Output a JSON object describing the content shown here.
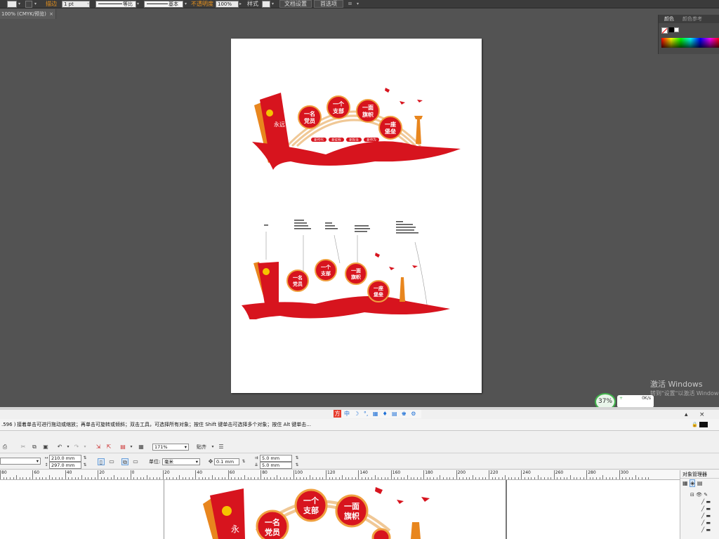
{
  "illustrator": {
    "control_bar": {
      "stroke_label": "描边",
      "stroke_weight": "1 pt",
      "uniform_label": "等比",
      "basic_label": "基本",
      "opacity_label": "不透明度",
      "opacity_value": "100%",
      "style_label": "样式",
      "document_setup_button": "文档设置",
      "preferences_button": "首选项"
    },
    "document_tab": {
      "label": "100% (CMYK/预览)",
      "close": "×"
    },
    "color_panel": {
      "tab_color": "颜色",
      "tab_color_guide": "颜色参考"
    },
    "accent_color": "#e8921c"
  },
  "artwork": {
    "circles": [
      "一名\n党员",
      "一个\n支部",
      "一面\n旗帜",
      "一座\n堡垒"
    ],
    "tags": [
      "新时代",
      "新征程",
      "新担当",
      "新作为"
    ],
    "flag_text": "永远跟党走",
    "brand_red": "#d7141e",
    "brand_orange": "#e8861e"
  },
  "overlay": {
    "windows_activation_title": "激活 Windows",
    "windows_activation_sub": "转到\"设置\"以激活 Windows。",
    "net_speed_percent": "37%",
    "net_speed_value": "0K/s",
    "net_speed_up": "+"
  },
  "corel": {
    "ime_icons": [
      "方",
      "中",
      "☽",
      "°,",
      "▦",
      "♦",
      "▤",
      "♚",
      "⚙"
    ],
    "status_prefix": ".596 )",
    "status_text": "接着单击可进行拖动或缩放；再单击可旋转或倾斜；双击工具，可选择所有对象；按住 Shift 键单击可选择多个对象；按住 Alt 键单击...",
    "zoom": "171%",
    "snap_label": "贴齐",
    "width": "210.0 mm",
    "height": "297.0 mm",
    "unit_label": "单位:",
    "unit_value": "毫米",
    "nudge": "0.1 mm",
    "dup_x": "5.0 mm",
    "dup_y": "5.0 mm",
    "object_manager_label": "对象管理器",
    "ruler_labels": [
      "80",
      "60",
      "40",
      "20",
      "0",
      "20",
      "40",
      "60",
      "80",
      "100",
      "120",
      "140",
      "160",
      "180",
      "200",
      "220",
      "240",
      "260",
      "280",
      "300"
    ]
  }
}
